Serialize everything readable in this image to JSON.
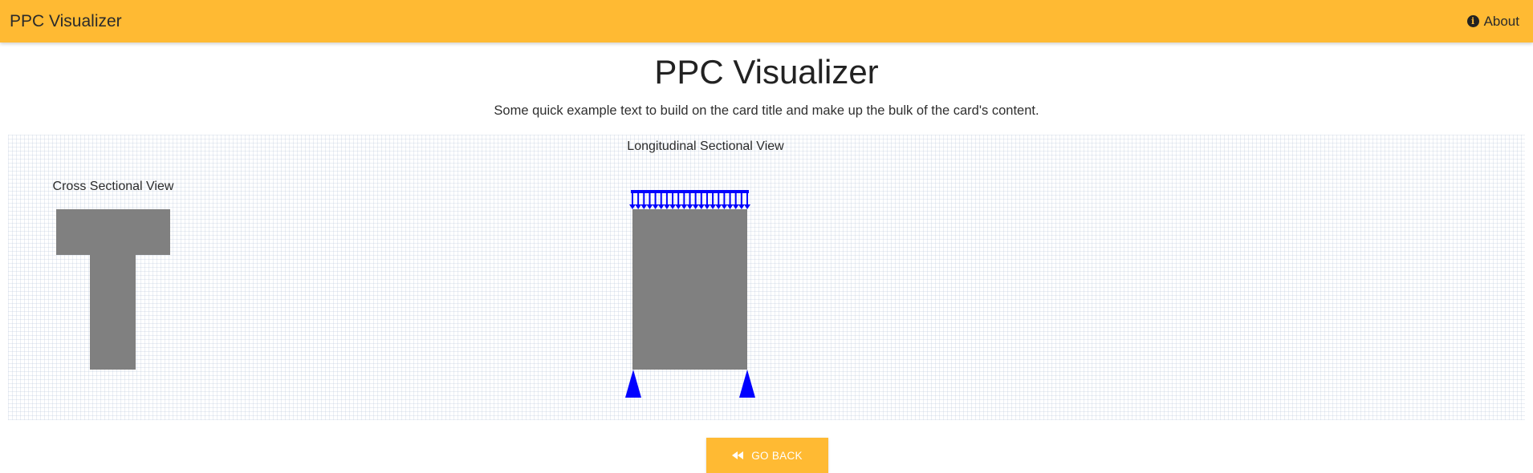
{
  "navbar": {
    "brand": "PPC Visualizer",
    "about_label": "About",
    "about_icon": "info-circle-icon",
    "color": "#ffba33"
  },
  "main": {
    "title": "PPC Visualizer",
    "subtitle": "Some quick example text to build on the card title and make up the bulk of the card's content."
  },
  "diagram": {
    "cross_section": {
      "label": "Cross Sectional View",
      "shape": "T-section",
      "color": "#808080"
    },
    "longitudinal_section": {
      "label": "Longitudinal Sectional View",
      "beam_color": "#808080",
      "load": "uniformly-distributed",
      "load_color": "#0000ff",
      "supports": [
        "pin",
        "pin"
      ],
      "support_color": "#0000ff"
    }
  },
  "actions": {
    "go_back_label": "GO BACK",
    "go_back_icon": "rewind-icon"
  }
}
